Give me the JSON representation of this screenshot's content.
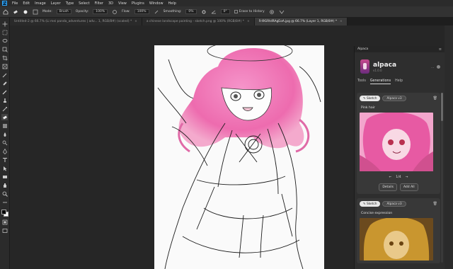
{
  "menu": [
    "File",
    "Edit",
    "Image",
    "Layer",
    "Type",
    "Select",
    "Filter",
    "3D",
    "View",
    "Plugins",
    "Window",
    "Help"
  ],
  "options": {
    "mode_label": "Mode:",
    "mode_value": "Brush",
    "opacity_label": "Opacity:",
    "opacity_value": "100%",
    "flow_label": "Flow:",
    "flow_value": "100%",
    "smoothing_label": "Smoothing:",
    "smoothing_value": "0%",
    "angle_value": "0°",
    "erase_history_label": "Erase to History"
  },
  "tabs": [
    {
      "label": "Untitled-2 @ 66.7% (Li mei panda_adventures | adv... 1, RGB/8#) (scaled) *"
    },
    {
      "label": "a chinese landscape painting - sketch.png @ 100% (RGB/8#) *"
    },
    {
      "label": "Fri9GRtdRAgEoA.jpg @ 66.7% (Layer 1, RGB/8#) *"
    }
  ],
  "panel": {
    "title": "Alpaca",
    "plugin_name": "alpaca",
    "version": "v1.0.0",
    "hide_label": "...",
    "subtabs": [
      "Tools",
      "Generations",
      "Help"
    ],
    "cards": [
      {
        "chip1": "✎ Sketch",
        "chip2": "Alpaca v3",
        "prompt": "Pink hair",
        "pager": "1/4",
        "details": "Details",
        "add_all": "Add All"
      },
      {
        "chip1": "✎ Sketch",
        "chip2": "Alpaca v3",
        "prompt": "Concise expression"
      }
    ]
  },
  "colors": {
    "hair": "#f07ab8",
    "accent": "#31a8ff"
  }
}
